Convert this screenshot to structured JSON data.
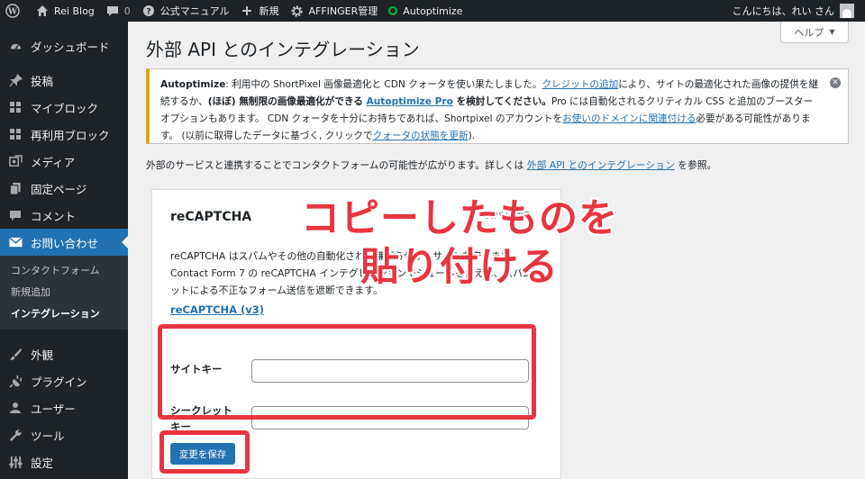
{
  "admin_bar": {
    "site_name": "Rei Blog",
    "comment_count": "0",
    "manual": "公式マニュアル",
    "new": "新規",
    "affinger": "AFFINGER管理",
    "autoptimize": "Autoptimize",
    "greeting": "こんにちは、れい さん"
  },
  "sidebar": {
    "items": [
      {
        "label": "ダッシュボード",
        "icon": "dashboard-icon"
      },
      {
        "label": "投稿",
        "icon": "pin-icon"
      },
      {
        "label": "マイブロック",
        "icon": "grid-icon"
      },
      {
        "label": "再利用ブロック",
        "icon": "grid-icon"
      },
      {
        "label": "メディア",
        "icon": "media-icon"
      },
      {
        "label": "固定ページ",
        "icon": "page-icon"
      },
      {
        "label": "コメント",
        "icon": "comment-icon"
      },
      {
        "label": "お問い合わせ",
        "icon": "mail-icon"
      }
    ],
    "submenu": [
      "コンタクトフォーム",
      "新規追加",
      "インテグレーション"
    ],
    "lower_items": [
      {
        "label": "外観",
        "icon": "brush-icon"
      },
      {
        "label": "プラグイン",
        "icon": "plugin-icon"
      },
      {
        "label": "ユーザー",
        "icon": "user-icon"
      },
      {
        "label": "ツール",
        "icon": "wrench-icon"
      },
      {
        "label": "設定",
        "icon": "settings-icon"
      }
    ]
  },
  "help_tab": "ヘルプ",
  "page_title": "外部 API とのインテグレーション",
  "notice": {
    "brand": "Autoptimize",
    "t1": ": 利用中の ShortPixel 画像最適化と CDN クォータを使い果たしました。",
    "link1": "クレジットの追加",
    "t2": "により、サイトの最適化された画像の提供を継続するか、",
    "bold1": "(ほぼ) 無制限の画像最適化ができる ",
    "link2": "Autoptimize Pro",
    "bold2": " を検討してください。",
    "t3": "Pro には自動化されるクリティカル CSS と追加のブースターオプションもあります。 CDN クォータを十分にお持ちであれば、Shortpixel のアカウントを",
    "link3": "お使いのドメインに関連付ける",
    "t4": "必要がある可能性があります。 (以前に取得したデータに基づく, クリックで",
    "link4": "クォータの状態を更新",
    "t5": ")."
  },
  "intro": {
    "text": "外部のサービスと連携することでコンタクトフォームの可能性が広がります。詳しくは ",
    "link": "外部 API とのインテグレーション",
    "suffix": " を参照。"
  },
  "card": {
    "title": "reCAPTCHA",
    "category": "スパム対策",
    "desc": "reCAPTCHA はスパムやその他の自動化された嫌がらせからサイトを守ります。Contact Form 7 の reCAPTCHA インテグレーションモジュールを使えば、スパムボットによる不正なフォーム送信を遮断できます。",
    "link": "reCAPTCHA (v3)",
    "site_key_label": "サイトキー",
    "secret_key_label": "シークレットキー",
    "site_key_value": "",
    "secret_key_value": "",
    "save_label": "変更を保存"
  },
  "annotation": "コピーしたものを貼り付ける",
  "colors": {
    "accent": "#2271b1",
    "highlight": "#e8353f",
    "admin_bg": "#1d2327",
    "notice_border": "#dba617"
  }
}
